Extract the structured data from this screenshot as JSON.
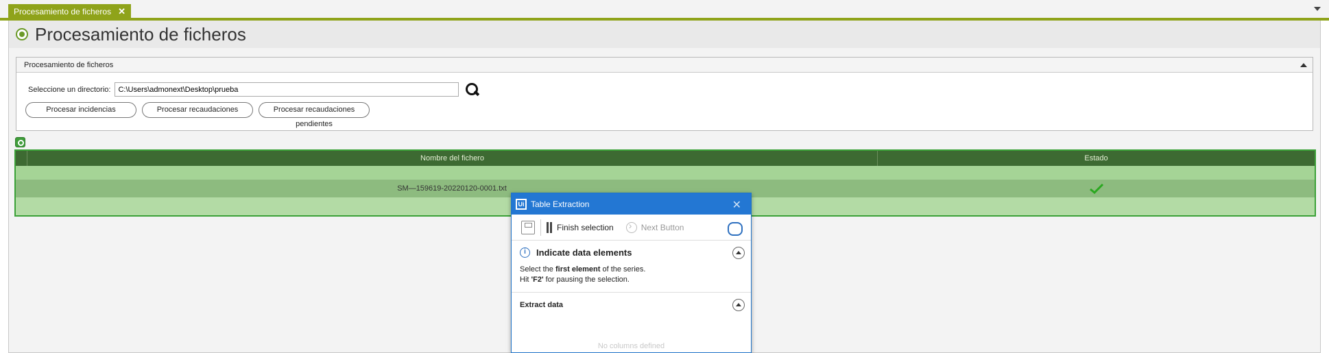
{
  "tab": {
    "label": "Procesamiento de ficheros",
    "close": "✕"
  },
  "page": {
    "title": "Procesamiento de ficheros"
  },
  "panel": {
    "title": "Procesamiento de ficheros",
    "directory_label": "Seleccione un directorio:",
    "directory_value": "C:\\Users\\admonext\\Desktop\\prueba",
    "buttons": [
      {
        "label": "Procesar incidencias"
      },
      {
        "label": "Procesar recaudaciones"
      },
      {
        "label": "Procesar recaudaciones pendientes"
      }
    ]
  },
  "grid": {
    "columns": [
      "Nombre del fichero",
      "Estado"
    ],
    "rows": [
      {
        "file": "SM—159619-20220120-0001.txt",
        "status_icon": "green-checkmark-icon"
      }
    ]
  },
  "dialog": {
    "title": "Table Extraction",
    "finish_label": "Finish selection",
    "next_label": "Next Button",
    "section1_title": "Indicate data elements",
    "line1_pre": "Select the ",
    "line1_bold": "first element",
    "line1_post": " of the series.",
    "line2_pre": "Hit ",
    "line2_bold": "'F2'",
    "line2_post": " for pausing the selection.",
    "section2_title": "Extract data",
    "empty_text": "No columns defined"
  },
  "colors": {
    "accent": "#8fa31a",
    "grid_header": "#3d6a32",
    "grid_row": "#a5d496",
    "dialog_title": "#2377d3"
  }
}
